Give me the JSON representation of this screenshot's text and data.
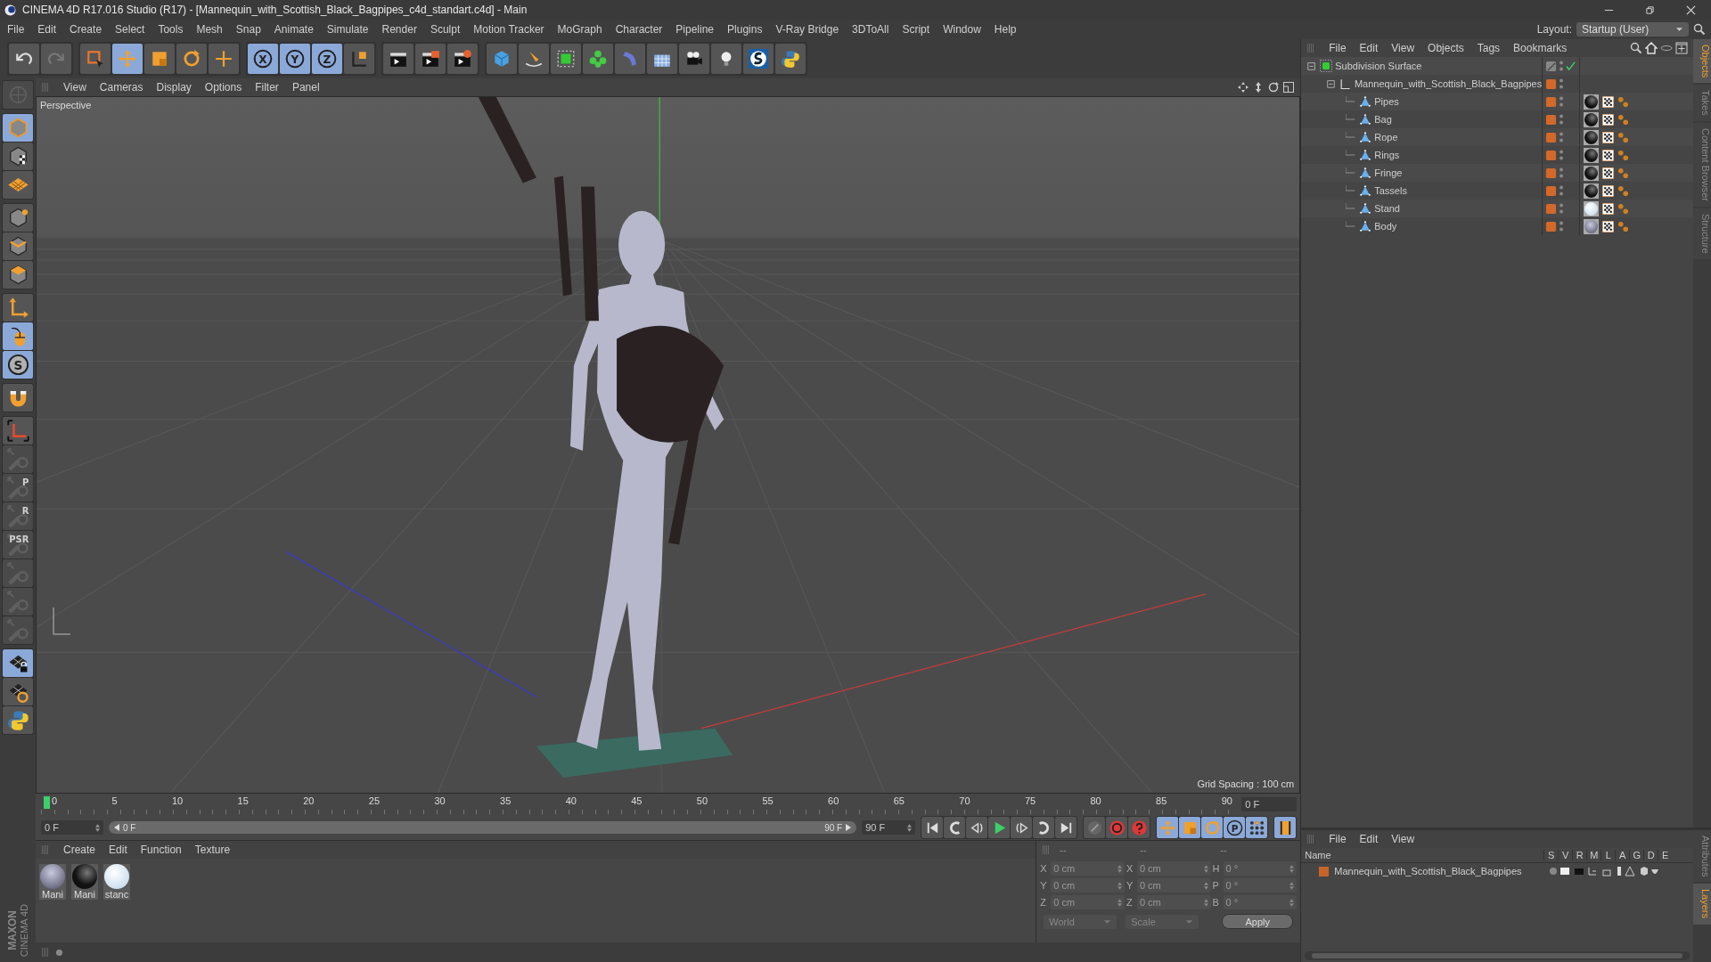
{
  "window": {
    "title": "CINEMA 4D R17.016 Studio (R17) - [Mannequin_with_Scottish_Black_Bagpipes_c4d_standart.c4d] - Main"
  },
  "menu": [
    "File",
    "Edit",
    "Create",
    "Select",
    "Tools",
    "Mesh",
    "Snap",
    "Animate",
    "Simulate",
    "Render",
    "Sculpt",
    "Motion Tracker",
    "MoGraph",
    "Character",
    "Pipeline",
    "Plugins",
    "V-Ray Bridge",
    "3DToAll",
    "Script",
    "Window",
    "Help"
  ],
  "layout": {
    "label": "Layout:",
    "value": "Startup (User)"
  },
  "toolbar": [
    [
      {
        "kind": "undo",
        "selected": false
      },
      {
        "kind": "redo",
        "selected": false
      }
    ],
    [
      {
        "kind": "select",
        "selected": false
      },
      {
        "kind": "move",
        "selected": true
      },
      {
        "kind": "scale",
        "selected": false
      },
      {
        "kind": "rotate",
        "selected": false
      },
      {
        "kind": "transform",
        "selected": false
      }
    ],
    [
      {
        "kind": "axis",
        "label": "X",
        "selected": true
      },
      {
        "kind": "axis",
        "label": "Y",
        "selected": true
      },
      {
        "kind": "axis",
        "label": "Z",
        "selected": true
      },
      {
        "kind": "coord",
        "selected": false
      }
    ],
    [
      {
        "kind": "render-view",
        "selected": false
      },
      {
        "kind": "render-picture",
        "selected": false
      },
      {
        "kind": "render-settings",
        "selected": false
      }
    ],
    [
      {
        "kind": "cube",
        "selected": false
      },
      {
        "kind": "pen",
        "selected": false
      },
      {
        "kind": "subdiv",
        "selected": false
      },
      {
        "kind": "cloner",
        "selected": false
      },
      {
        "kind": "deformer",
        "selected": false
      },
      {
        "kind": "floor",
        "selected": false
      },
      {
        "kind": "camera",
        "selected": false
      },
      {
        "kind": "light",
        "selected": false
      },
      {
        "kind": "sketch",
        "selected": false
      },
      {
        "kind": "python",
        "selected": false
      }
    ]
  ],
  "left_toolbar": [
    [
      {
        "kind": "editable",
        "selected": false,
        "disabled": true
      }
    ],
    [
      {
        "kind": "model",
        "selected": true,
        "disabled": false
      },
      {
        "kind": "texture",
        "selected": false,
        "disabled": false
      },
      {
        "kind": "workplane",
        "selected": false,
        "disabled": false
      }
    ],
    [
      {
        "kind": "points",
        "selected": false,
        "disabled": false
      },
      {
        "kind": "edges",
        "selected": false,
        "disabled": false
      },
      {
        "kind": "polygons",
        "selected": false,
        "disabled": false
      }
    ],
    [
      {
        "kind": "axis-mode",
        "selected": false,
        "disabled": false
      },
      {
        "kind": "tweak",
        "selected": true,
        "disabled": false
      },
      {
        "kind": "solo",
        "label": "S",
        "selected": true,
        "disabled": false
      }
    ],
    [
      {
        "kind": "magnet",
        "selected": false,
        "disabled": false
      }
    ],
    [
      {
        "kind": "snap",
        "selected": false,
        "disabled": false
      },
      {
        "kind": "key",
        "selected": false,
        "disabled": true
      },
      {
        "kind": "key",
        "label": "P",
        "selected": false,
        "disabled": true
      },
      {
        "kind": "key",
        "label": "R",
        "selected": false,
        "disabled": true
      },
      {
        "kind": "key",
        "label": "PSR",
        "selected": false,
        "disabled": true
      },
      {
        "kind": "key",
        "selected": false,
        "disabled": true
      },
      {
        "kind": "key",
        "selected": false,
        "disabled": true
      },
      {
        "kind": "key",
        "selected": false,
        "disabled": true
      }
    ],
    [
      {
        "kind": "lock-workplane",
        "selected": true,
        "disabled": false
      },
      {
        "kind": "workplane-rotate",
        "selected": false,
        "disabled": false
      },
      {
        "kind": "python",
        "selected": false,
        "disabled": false
      }
    ]
  ],
  "brand": [
    "MAXON",
    "CINEMA 4D"
  ],
  "viewport": {
    "menu": [
      "View",
      "Cameras",
      "Display",
      "Options",
      "Filter",
      "Panel"
    ],
    "camera": "Perspective",
    "grid_spacing": "Grid Spacing : 100 cm"
  },
  "timeline": {
    "ticks": [
      "0",
      "5",
      "10",
      "15",
      "20",
      "25",
      "30",
      "35",
      "40",
      "45",
      "50",
      "55",
      "60",
      "65",
      "70",
      "75",
      "80",
      "85",
      "90"
    ],
    "current_frame": "0 F",
    "start_field": "0 F",
    "range_start": "0 F",
    "range_end": "90 F",
    "end_field": "90 F",
    "level": 1
  },
  "transport": [
    [
      {
        "kind": "start",
        "selected": false
      },
      {
        "kind": "prev-key",
        "selected": false
      },
      {
        "kind": "prev-frame",
        "selected": false
      },
      {
        "kind": "play",
        "selected": false
      },
      {
        "kind": "next-frame",
        "selected": false
      },
      {
        "kind": "next-key",
        "selected": false
      },
      {
        "kind": "end",
        "selected": false
      }
    ],
    [
      {
        "kind": "keyframe",
        "selected": false
      },
      {
        "kind": "record",
        "selected": false
      },
      {
        "kind": "autokey",
        "selected": false
      }
    ],
    [
      {
        "kind": "move",
        "selected": true
      },
      {
        "kind": "scale",
        "selected": true
      },
      {
        "kind": "rotate",
        "selected": true
      },
      {
        "kind": "param",
        "label": "P",
        "selected": true
      },
      {
        "kind": "dots",
        "selected": true
      }
    ],
    [
      {
        "kind": "film",
        "selected": true
      }
    ]
  ],
  "material_manager": {
    "menu": [
      "Create",
      "Edit",
      "Function",
      "Texture"
    ],
    "materials": [
      {
        "label": "Mani",
        "kind": "grey"
      },
      {
        "label": "Mani",
        "kind": "black"
      },
      {
        "label": "stanc",
        "kind": "white"
      }
    ]
  },
  "coordinates": {
    "headers": [
      "--",
      "--",
      "--"
    ],
    "rows": [
      {
        "cells": [
          {
            "axis": "X",
            "value": "0 cm"
          },
          {
            "axis": "X",
            "value": "0 cm"
          },
          {
            "axis": "H",
            "value": "0 °"
          }
        ]
      },
      {
        "cells": [
          {
            "axis": "Y",
            "value": "0 cm"
          },
          {
            "axis": "Y",
            "value": "0 cm"
          },
          {
            "axis": "P",
            "value": "0 °"
          }
        ]
      },
      {
        "cells": [
          {
            "axis": "Z",
            "value": "0 cm"
          },
          {
            "axis": "Z",
            "value": "0 cm"
          },
          {
            "axis": "B",
            "value": "0 °"
          }
        ]
      }
    ],
    "space": "World",
    "mode": "Scale",
    "apply": "Apply"
  },
  "object_manager": {
    "menu": [
      "File",
      "Edit",
      "View",
      "Objects",
      "Tags",
      "Bookmarks"
    ],
    "tree": [
      {
        "name": "Subdivision Surface",
        "kind": "generator",
        "checked": true,
        "children": [
          {
            "name": "Mannequin_with_Scottish_Black_Bagpipes",
            "kind": "null",
            "checked": false,
            "children": [
              {
                "name": "Pipes",
                "kind": "mesh",
                "checked": false,
                "tags": [
                  {
                    "kind": "black"
                  },
                  {
                    "kind": "uvw"
                  },
                  {
                    "kind": "phong"
                  }
                ]
              },
              {
                "name": "Bag",
                "kind": "mesh",
                "checked": false,
                "tags": [
                  {
                    "kind": "black"
                  },
                  {
                    "kind": "uvw"
                  },
                  {
                    "kind": "phong"
                  }
                ]
              },
              {
                "name": "Rope",
                "kind": "mesh",
                "checked": false,
                "tags": [
                  {
                    "kind": "black"
                  },
                  {
                    "kind": "uvw"
                  },
                  {
                    "kind": "phong"
                  }
                ]
              },
              {
                "name": "Rings",
                "kind": "mesh",
                "checked": false,
                "tags": [
                  {
                    "kind": "black"
                  },
                  {
                    "kind": "uvw"
                  },
                  {
                    "kind": "phong"
                  }
                ]
              },
              {
                "name": "Fringe",
                "kind": "mesh",
                "checked": false,
                "tags": [
                  {
                    "kind": "black"
                  },
                  {
                    "kind": "uvw"
                  },
                  {
                    "kind": "phong"
                  }
                ]
              },
              {
                "name": "Tassels",
                "kind": "mesh",
                "checked": false,
                "tags": [
                  {
                    "kind": "black"
                  },
                  {
                    "kind": "uvw"
                  },
                  {
                    "kind": "phong"
                  }
                ]
              },
              {
                "name": "Stand",
                "kind": "mesh",
                "checked": false,
                "tags": [
                  {
                    "kind": "white"
                  },
                  {
                    "kind": "uvw"
                  },
                  {
                    "kind": "phong"
                  }
                ]
              },
              {
                "name": "Body",
                "kind": "mesh",
                "checked": false,
                "tags": [
                  {
                    "kind": "grey"
                  },
                  {
                    "kind": "uvw"
                  },
                  {
                    "kind": "phong"
                  }
                ]
              }
            ]
          }
        ]
      }
    ]
  },
  "side_tabs_top": [
    {
      "label": "Objects",
      "selected": true
    },
    {
      "label": "Takes",
      "selected": false
    },
    {
      "label": "Content Browser",
      "selected": false
    },
    {
      "label": "Structure",
      "selected": false
    }
  ],
  "layer_manager": {
    "menu": [
      "File",
      "Edit",
      "View"
    ],
    "columns": [
      "Name",
      "S",
      "V",
      "R",
      "M",
      "L",
      "A",
      "G",
      "D",
      "E"
    ],
    "rows": [
      {
        "name": "Mannequin_with_Scottish_Black_Bagpipes",
        "color": "#c8642a"
      }
    ]
  },
  "side_tabs_bottom": [
    {
      "label": "Attributes",
      "selected": false
    },
    {
      "label": "Layers",
      "selected": true
    }
  ]
}
